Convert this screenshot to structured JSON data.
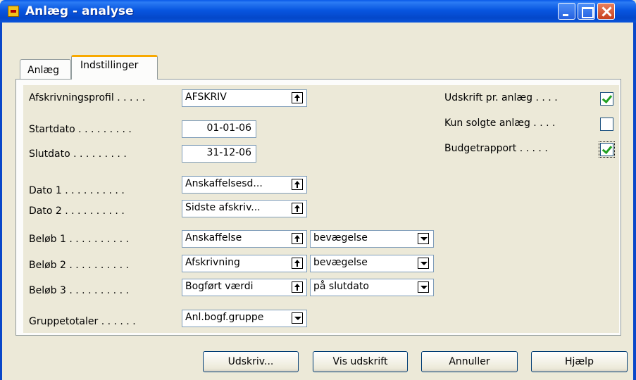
{
  "window": {
    "title": "Anlæg - analyse"
  },
  "tabs": [
    {
      "label": "Anlæg"
    },
    {
      "label": "Indstillinger"
    }
  ],
  "fields": {
    "afskrivningsprofil": {
      "label": "Afskrivningsprofil . . . . .",
      "value": "AFSKRIV"
    },
    "startdato": {
      "label": "Startdato . . . . . . . . .",
      "value": "01-01-06"
    },
    "slutdato": {
      "label": "Slutdato . . . . . . . . .",
      "value": "31-12-06"
    },
    "dato1": {
      "label": "Dato 1 . . . . . . . . . .",
      "value": "Anskaffelsesd..."
    },
    "dato2": {
      "label": "Dato 2 . . . . . . . . . .",
      "value": "Sidste afskriv..."
    },
    "beloeb1": {
      "label": "Beløb 1 . . . . . . . . . .",
      "value": "Anskaffelse",
      "type": "bevægelse"
    },
    "beloeb2": {
      "label": "Beløb 2 . . . . . . . . . .",
      "value": "Afskrivning",
      "type": "bevægelse"
    },
    "beloeb3": {
      "label": "Beløb 3 . . . . . . . . . .",
      "value": "Bogført værdi",
      "type": "på slutdato"
    },
    "gruppetotaler": {
      "label": "Gruppetotaler . . . . . .",
      "value": "Anl.bogf.gruppe"
    }
  },
  "options": {
    "udskrift_pr_anlaeg": {
      "label": "Udskrift pr. anlæg . . . .",
      "checked": true
    },
    "kun_solgte_anlaeg": {
      "label": "Kun solgte anlæg . . . .",
      "checked": false
    },
    "budgetrapport": {
      "label": "Budgetrapport . . . . .",
      "checked": true
    }
  },
  "buttons": {
    "udskriv": "Udskriv...",
    "vis_udskrift": "Vis udskrift",
    "annuller": "Annuller",
    "hjaelp": "Hjælp"
  }
}
